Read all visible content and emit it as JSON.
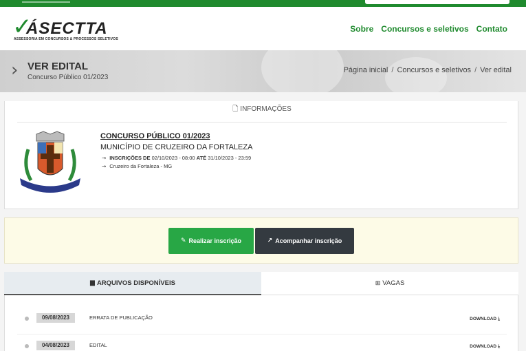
{
  "brand": {
    "name": "ÁSECTTA",
    "tagline": "ASSESSORIA EM CONCURSOS & PROCESSOS SELETIVOS"
  },
  "nav": [
    "Sobre",
    "Concursos e seletivos",
    "Contato"
  ],
  "header": {
    "title": "VER EDITAL",
    "subtitle": "Concurso Público 01/2023",
    "breadcrumb": [
      "Página inicial",
      "Concursos e seletivos",
      "Ver edital"
    ]
  },
  "info": {
    "section_label": "INFORMAÇÕES",
    "title": "CONCURSO PÚBLICO 01/2023",
    "municipality": "MUNICÍPIO DE CRUZEIRO DA FORTALEZA",
    "inscricoes_label": "INSCRIÇÕES DE",
    "start": "02/10/2023 - 08:00",
    "ate_label": "ATÉ",
    "end": "31/10/2023 - 23:59",
    "location": "Cruzeiro da Fortaleza - MG"
  },
  "actions": {
    "register": "Realizar inscrição",
    "track": "Acompanhar inscrição"
  },
  "tabs": {
    "files": "ARQUIVOS DISPONÍVEIS",
    "vacancies": "VAGAS"
  },
  "files": [
    {
      "date": "09/08/2023",
      "name": "ERRATA DE PUBLICAÇÃO",
      "action": "DOWNLOAD"
    },
    {
      "date": "04/08/2023",
      "name": "EDITAL",
      "action": "DOWNLOAD"
    }
  ],
  "colors": {
    "brand_green": "#1f8a2e",
    "button_green": "#28a745",
    "button_dark": "#343a40",
    "notice_bg": "#fdfbe7"
  }
}
